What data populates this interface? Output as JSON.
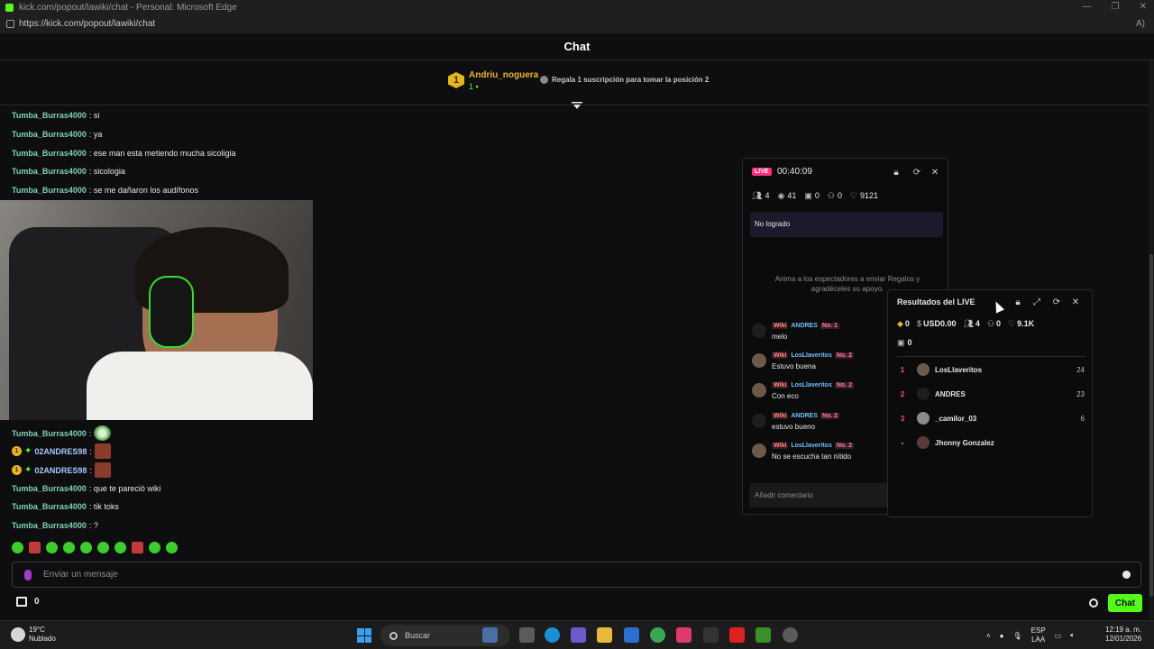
{
  "browser": {
    "window_title": "kick.com/popout/lawiki/chat - Personal: Microsoft Edge",
    "url": "https://kick.com/popout/lawiki/chat"
  },
  "chat": {
    "header_title": "Chat",
    "pinned": {
      "position": "1",
      "username": "Andriu_noguera",
      "count": "1",
      "cta": "Regala 1 suscripción para tomar la posición 2"
    },
    "messages": [
      {
        "user": "Tumba_Burras4000",
        "text": ": si"
      },
      {
        "user": "Tumba_Burras4000",
        "text": ": ya"
      },
      {
        "user": "Tumba_Burras4000",
        "text": ": ese man esta metiendo mucha sicoligia"
      },
      {
        "user": "Tumba_Burras4000",
        "text": ": sicologia"
      },
      {
        "user": "Tumba_Burras4000",
        "text": ": se me dañaron los audífonos"
      },
      {
        "user": "Tumba_Burras4000",
        "text": ":"
      },
      {
        "user": "02ANDRES98",
        "text": ":",
        "badge": "1"
      },
      {
        "user": "02ANDRES98",
        "text": ":",
        "badge": "1"
      },
      {
        "user": "Tumba_Burras4000",
        "text": ": que te pareció wiki"
      },
      {
        "user": "Tumba_Burras4000",
        "text": ": tik toks"
      },
      {
        "user": "Tumba_Burras4000",
        "text": ": ?"
      }
    ],
    "input_placeholder": "Enviar un mensaje",
    "bottom_count": "0",
    "send_label": "Chat"
  },
  "live_panel": {
    "badge": "LIVE",
    "timer": "00:40:09",
    "stats": {
      "viewers_people": "4",
      "views": "41",
      "gifts": "0",
      "followers": "0",
      "likes": "9121"
    },
    "goal_status": "No logrado",
    "gift_hint": "Anima a los espectadores a enviar Regalos y agradéceles su apoyo.",
    "comments": [
      {
        "user": "ANDRES",
        "rank": "No. 1",
        "text": "melo",
        "tag": "Wiki"
      },
      {
        "user": "LosLlaveritos",
        "rank": "No. 2",
        "text": "Estuvo buena",
        "tag": "Wiki"
      },
      {
        "user": "LosLlaveritos",
        "rank": "No. 2",
        "text": "Con eco",
        "tag": "Wiki"
      },
      {
        "user": "ANDRES",
        "rank": "No. 2",
        "text": "estuvo bueno",
        "tag": "Wiki"
      },
      {
        "user": "LosLlaveritos",
        "rank": "No. 2",
        "text": "No se escucha tan nítido",
        "tag": "Wiki"
      }
    ],
    "comment_placeholder": "Añadir comentario"
  },
  "results_panel": {
    "title": "Resultados del LIVE",
    "diamonds": "0",
    "usd": "USD0.00",
    "people": "4",
    "followers": "0",
    "likes": "9.1K",
    "gifts": "0",
    "ranking": [
      {
        "pos": "1",
        "name": "LosLlaveritos",
        "score": "24"
      },
      {
        "pos": "2",
        "name": "ANDRES",
        "score": "23"
      },
      {
        "pos": "3",
        "name": "_camilor_03",
        "score": "6"
      },
      {
        "pos": "-",
        "name": "Jhonny  Gonzalez",
        "score": ""
      }
    ]
  },
  "taskbar": {
    "weather_temp": "19°C",
    "weather_desc": "Nublado",
    "search_label": "Buscar",
    "lang_top": "ESP",
    "lang_bottom": "LAA",
    "time": "12:19 a. m.",
    "date": "12/01/2026"
  },
  "colors": {
    "kick_green": "#53fc18",
    "live_pink": "#ff2e7b",
    "gold": "#e9b51d",
    "username_teal": "#7fd1b9"
  }
}
